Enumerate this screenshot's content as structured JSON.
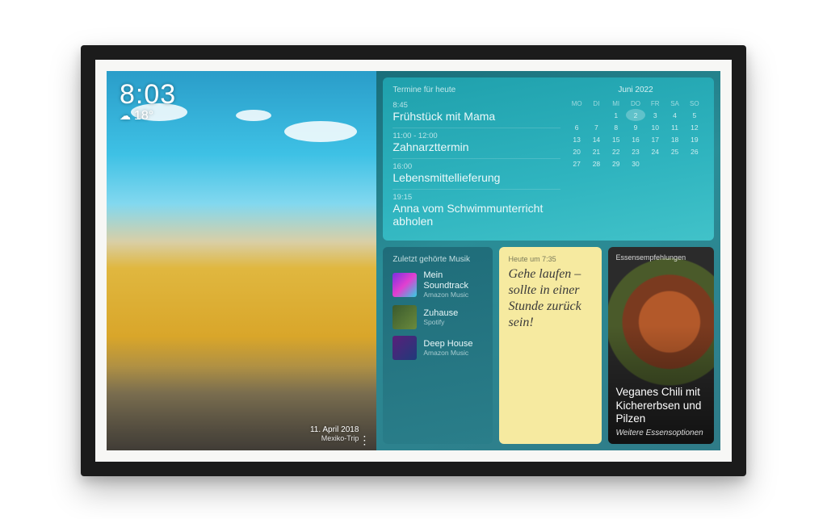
{
  "clock": {
    "time": "8:03",
    "temperature": "18°"
  },
  "photo": {
    "date": "11. April 2018",
    "album": "Mexiko-Trip"
  },
  "schedule": {
    "title": "Termine für heute",
    "events": [
      {
        "time": "8:45",
        "label": "Frühstück mit Mama"
      },
      {
        "time": "11:00 - 12:00",
        "label": "Zahnarzttermin"
      },
      {
        "time": "16:00",
        "label": "Lebensmittellieferung"
      },
      {
        "time": "19:15",
        "label": "Anna vom Schwimmunterricht abholen"
      }
    ]
  },
  "calendar": {
    "month_label": "Juni 2022",
    "weekdays": [
      "MO",
      "DI",
      "MI",
      "DO",
      "FR",
      "SA",
      "SO"
    ],
    "today": 2,
    "rows": [
      [
        "",
        "",
        "1",
        "2",
        "3",
        "4",
        "5"
      ],
      [
        "6",
        "7",
        "8",
        "9",
        "10",
        "11",
        "12"
      ],
      [
        "13",
        "14",
        "15",
        "16",
        "17",
        "18",
        "19"
      ],
      [
        "20",
        "21",
        "22",
        "23",
        "24",
        "25",
        "26"
      ],
      [
        "27",
        "28",
        "29",
        "30",
        "",
        "",
        ""
      ]
    ]
  },
  "music": {
    "title": "Zuletzt gehörte Musik",
    "tracks": [
      {
        "name": "Mein Soundtrack",
        "source": "Amazon Music"
      },
      {
        "name": "Zuhause",
        "source": "Spotify"
      },
      {
        "name": "Deep House",
        "source": "Amazon Music"
      }
    ]
  },
  "note": {
    "header": "Heute um 7:35",
    "text": "Gehe laufen – sollte in einer Stunde zurück sein!"
  },
  "food": {
    "title": "Essensempfehlungen",
    "name": "Veganes Chili mit Kichererbsen und Pilzen",
    "more": "Weitere Essensoptionen"
  }
}
